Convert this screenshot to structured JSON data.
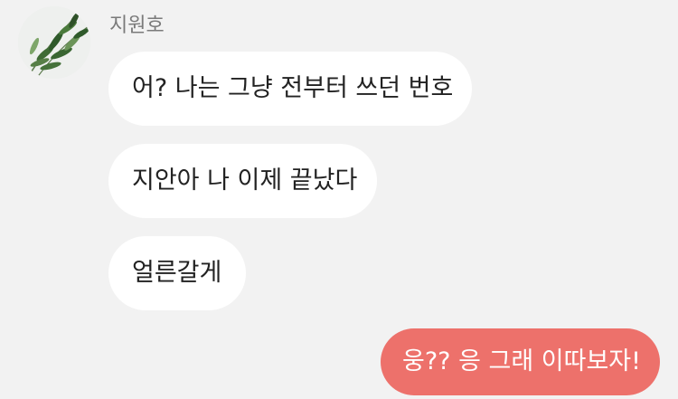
{
  "chat": {
    "sender_name": "지원호",
    "avatar_icon": "plant-leaves-avatar",
    "messages": [
      {
        "direction": "incoming",
        "text": "어? 나는 그냥 전부터 쓰던 번호"
      },
      {
        "direction": "incoming",
        "text": "지안아 나 이제 끝났다"
      },
      {
        "direction": "incoming",
        "text": "얼른갈게"
      },
      {
        "direction": "outgoing",
        "text": "웅?? 응 그래 이따보자!"
      }
    ]
  },
  "colors": {
    "background": "#f2f2f2",
    "incoming_bubble": "#ffffff",
    "outgoing_bubble": "#ed716b",
    "sender_name": "#7a7a7a"
  }
}
